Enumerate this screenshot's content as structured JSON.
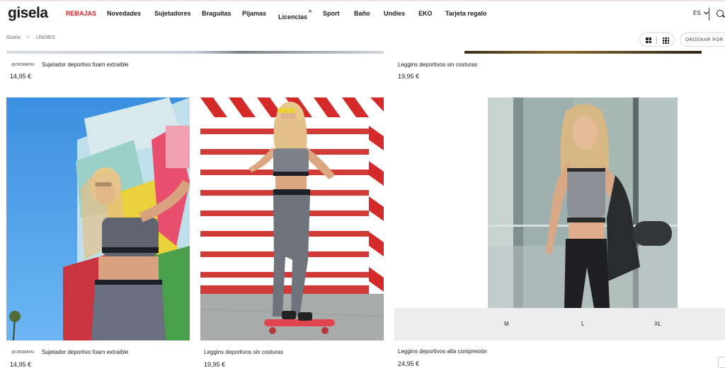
{
  "header": {
    "logo": "gisela",
    "nav": [
      {
        "label": "REBAJAS",
        "sale": true
      },
      {
        "label": "Novedades"
      },
      {
        "label": "Sujetadores"
      },
      {
        "label": "Braguitas"
      },
      {
        "label": "Pijamas"
      },
      {
        "label": "Licencias",
        "sup": "®"
      },
      {
        "label": "Sport"
      },
      {
        "label": "Baño"
      },
      {
        "label": "Undies"
      },
      {
        "label": "EKO"
      },
      {
        "label": "Tarjeta regalo"
      }
    ],
    "language": "ES",
    "language_chevron": "chevron-down-icon",
    "search_icon": "search-icon"
  },
  "breadcrumb": {
    "home": "Gisela",
    "separator": ">",
    "current": "UNDIES"
  },
  "toolbar": {
    "grid_large_icon": "grid-2x2-icon",
    "grid_small_icon": "grid-3x3-icon",
    "sort_label": "ORDENAR POR"
  },
  "top_row": [
    {
      "tag": "@CRISMATA1",
      "name": "Sujetador deportivo foam extraíble",
      "price": "14,95 €"
    },
    {
      "name": "Leggins deportivos sin costuras",
      "price": "19,95 €"
    }
  ],
  "products": [
    {
      "tag": "@CRISMATA1",
      "name": "Sujetador deportivo foam extraíble",
      "price": "14,95 €"
    },
    {
      "name": "Leggins deportivos sin costuras",
      "price": "19,95 €"
    },
    {
      "name": "Leggins deportivos alta compresión",
      "price": "24,95 €",
      "sizes": [
        "M",
        "L",
        "XL"
      ]
    }
  ],
  "colors": {
    "sale": "#d5232e",
    "text": "#1a1a1a"
  }
}
